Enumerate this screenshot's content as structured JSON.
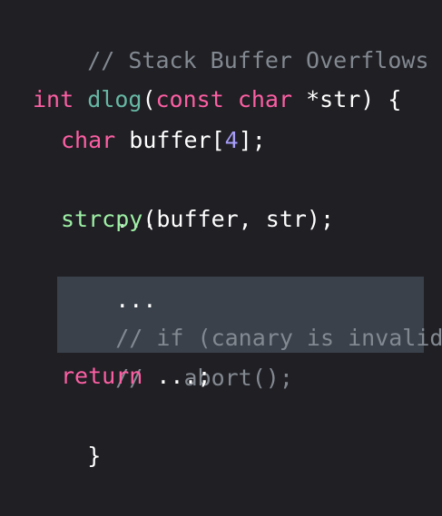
{
  "code": {
    "header_comment": "// Stack Buffer Overflows",
    "line_decl": {
      "kw_int": "int",
      "fn_name": "dlog",
      "paren_open": "(",
      "kw_const": "const",
      "kw_char": "char",
      "param": " *str) {"
    },
    "line_buffer": {
      "kw_char": "char",
      "ident": " buffer[",
      "number": "4",
      "close": "];"
    },
    "ellipsis_1": "...",
    "line_strcpy": {
      "fn_name": "strcpy",
      "args": "(buffer, str);"
    },
    "ellipsis_2": "...",
    "comment_if": "// if (canary is invalid)",
    "comment_abort": "//   abort();",
    "line_return": {
      "kw_return": "return",
      "rest": " ...;"
    },
    "closing_brace": "}"
  },
  "colors": {
    "background": "#1f1f24",
    "comment": "#838991",
    "keyword": "#fc5fa3",
    "function": "#67b7a4",
    "number": "#a79df9",
    "highlight": "#3a414b"
  }
}
